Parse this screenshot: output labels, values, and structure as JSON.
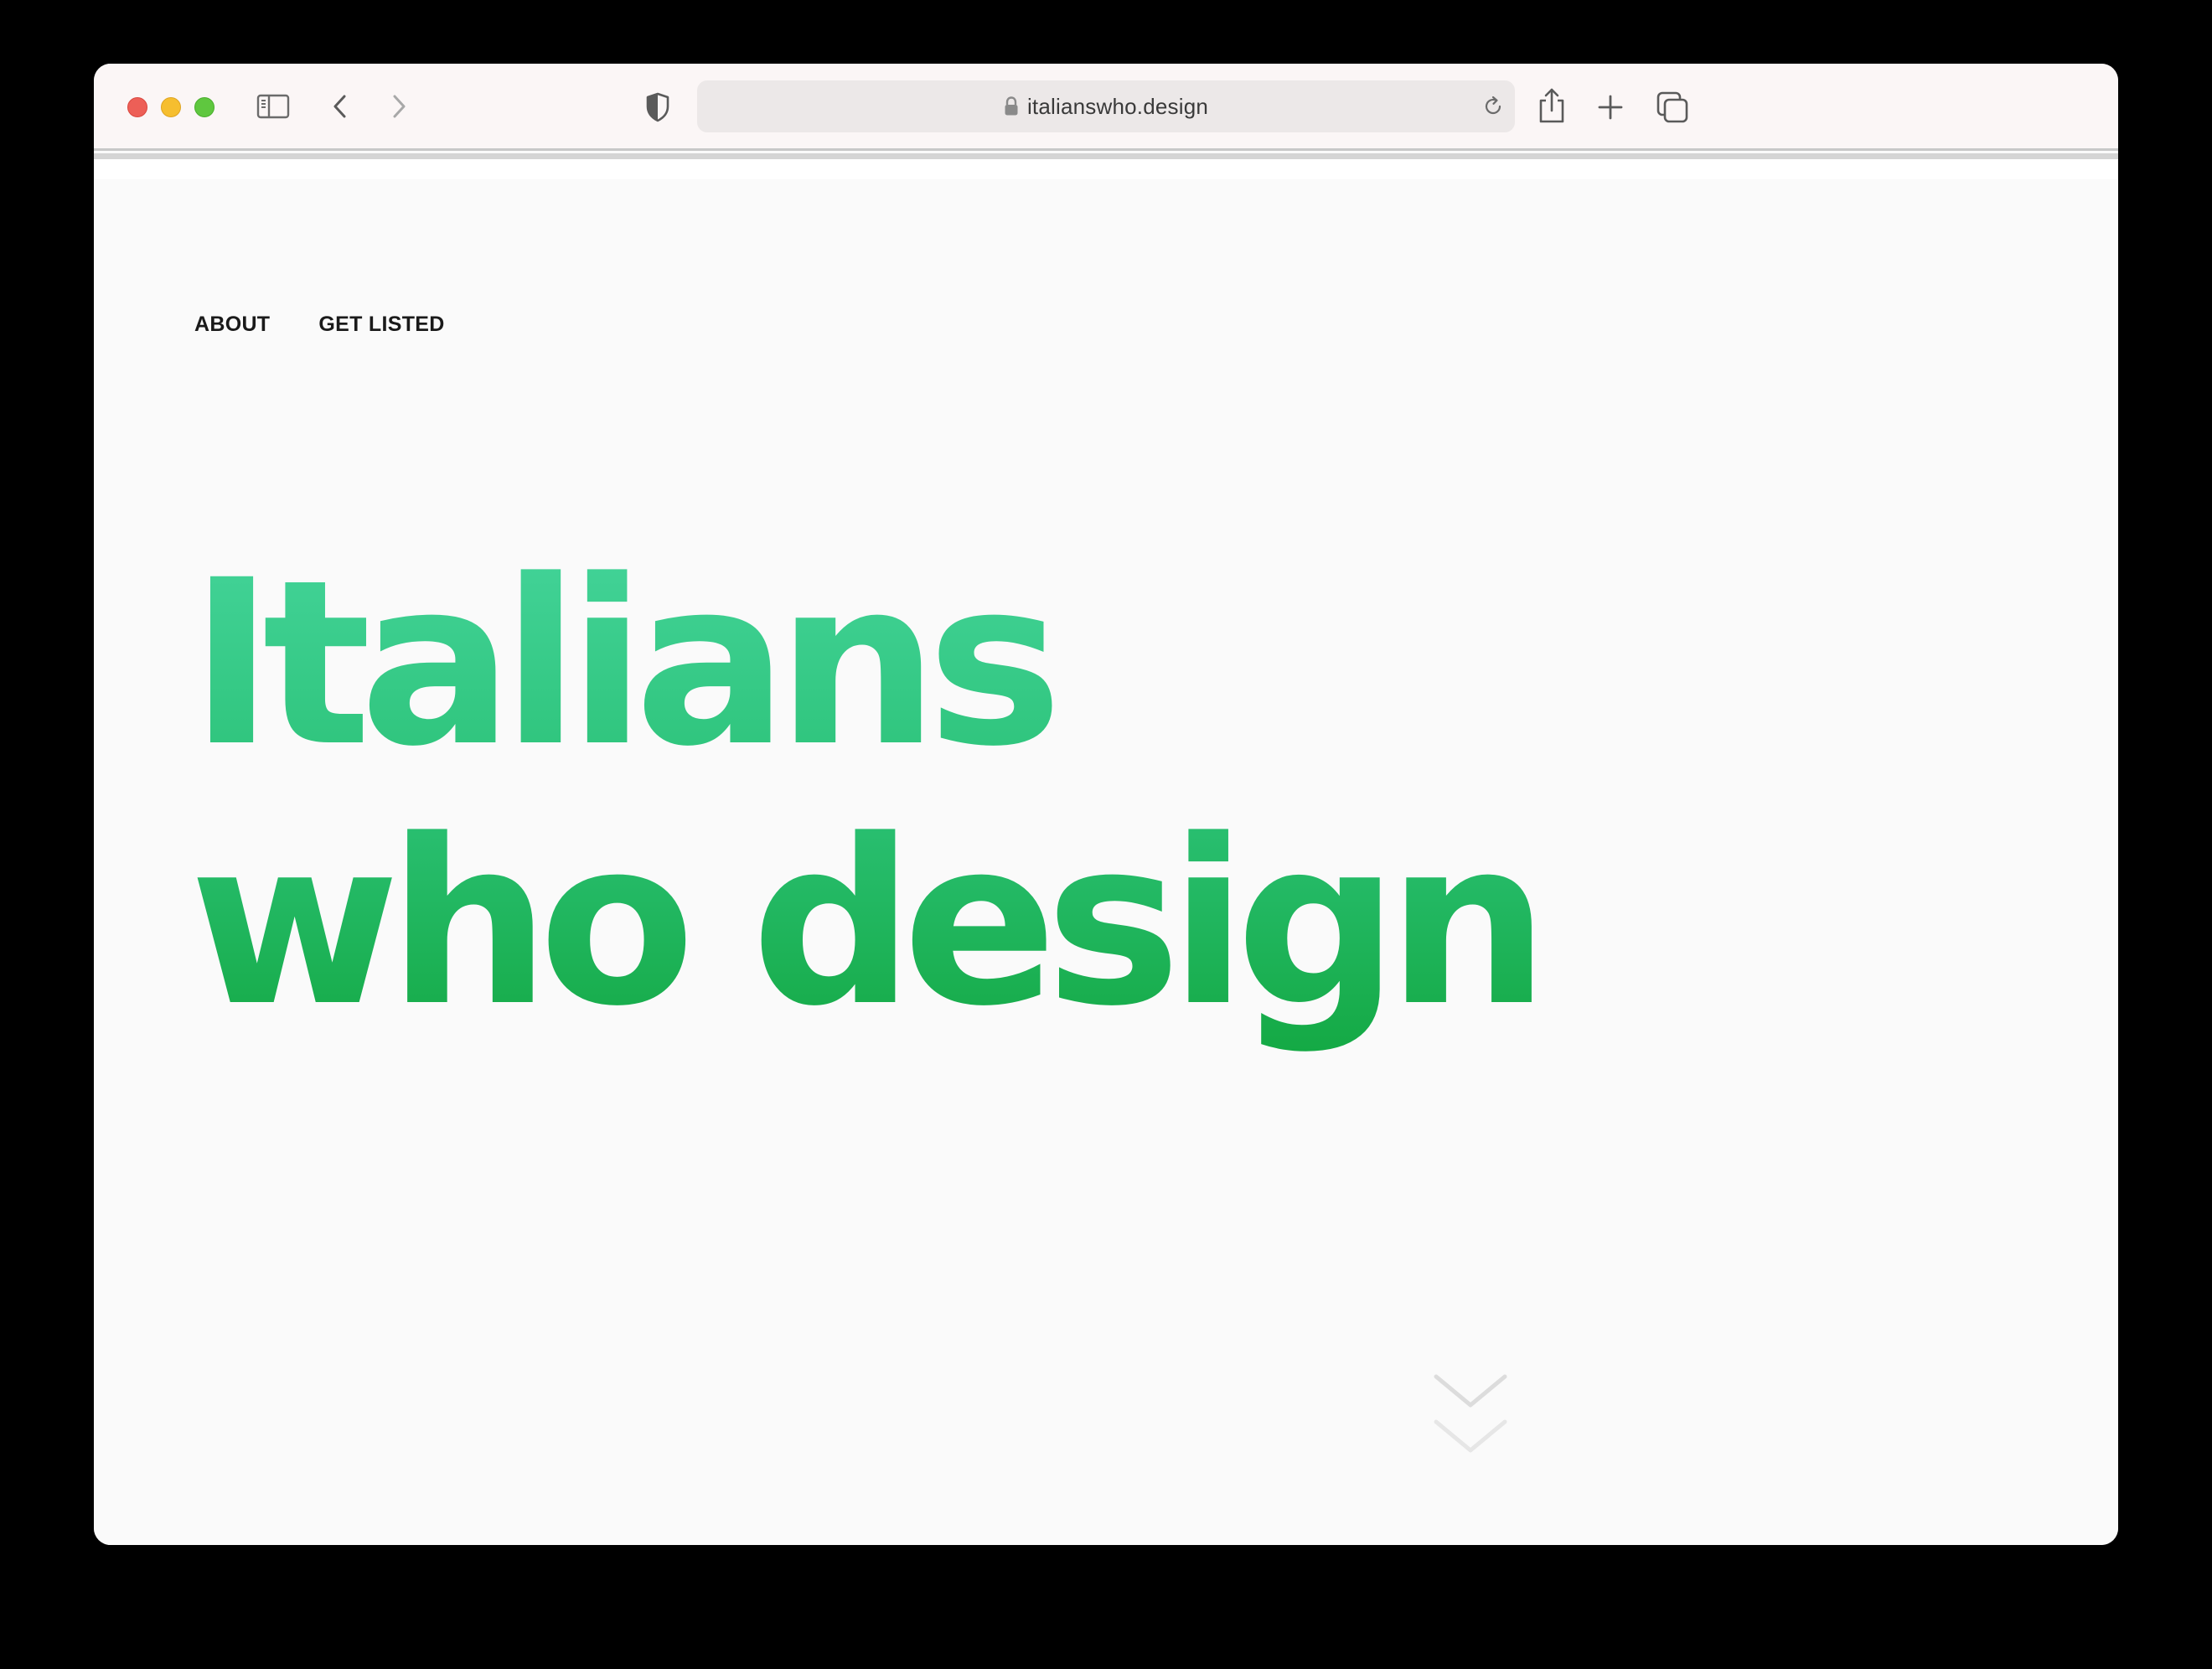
{
  "browser": {
    "url": "italianswho.design",
    "controls": {
      "close": "close",
      "minimize": "minimize",
      "maximize": "maximize"
    },
    "icons": [
      "sidebar-icon",
      "back-icon",
      "forward-icon",
      "shield-icon",
      "lock-icon",
      "reload-icon",
      "share-icon",
      "new-tab-icon",
      "tab-overview-icon"
    ],
    "colors": {
      "close": "#ed5f57",
      "minimize": "#f6be2f",
      "maximize": "#5fc73f",
      "toolbar": "#fbf6f6"
    }
  },
  "site": {
    "nav": {
      "about": "ABOUT",
      "get_listed": "GET LISTED"
    },
    "hero": {
      "line1": "Italians",
      "line2": "who design"
    },
    "colors": {
      "hero_top": "#44d49a",
      "hero_bottom": "#14a944",
      "background": "#fafafa"
    },
    "scroll_indicator_icon": "double-chevron-down-icon"
  }
}
